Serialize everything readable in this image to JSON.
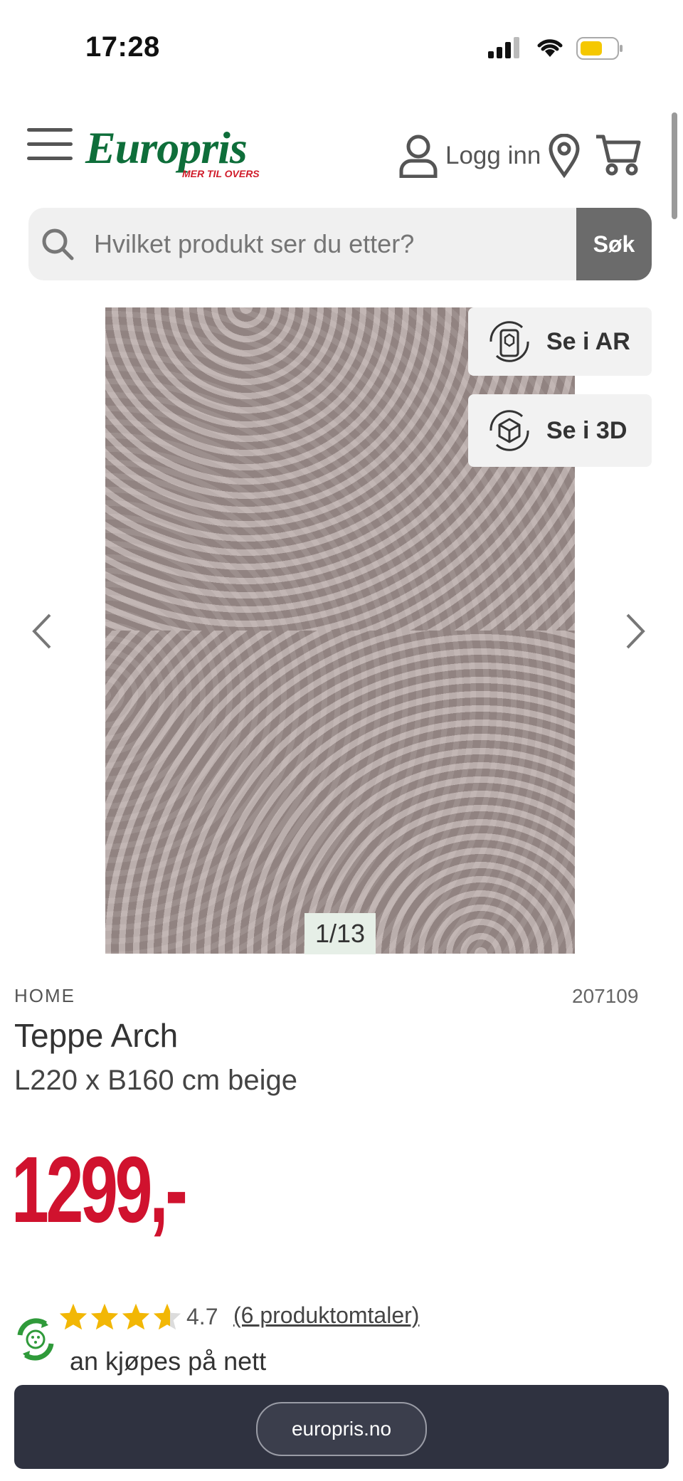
{
  "status_bar": {
    "time": "17:28"
  },
  "header": {
    "logo_text": "Europris",
    "logo_tagline": "MER TIL OVERS",
    "login_label": "Logg inn"
  },
  "search": {
    "placeholder": "Hvilket produkt ser du etter?",
    "button_label": "Søk"
  },
  "gallery": {
    "counter": "1/13",
    "ar_label": "Se i AR",
    "view3d_label": "Se i 3D"
  },
  "product": {
    "brand": "HOME",
    "sku": "207109",
    "title": "Teppe Arch",
    "subtitle": "L220 x B160 cm beige",
    "price": "1299,-",
    "rating_value": "4.7",
    "rating_stars": 4.7,
    "reviews_label": "(6 produktomtaler)",
    "availability": "an kjøpes på nett"
  },
  "browser": {
    "url": "europris.no"
  },
  "colors": {
    "brand_green": "#0e6e3a",
    "price_red": "#d0122e",
    "star_yellow": "#f2b705",
    "bottom_bar": "#2f3240"
  }
}
